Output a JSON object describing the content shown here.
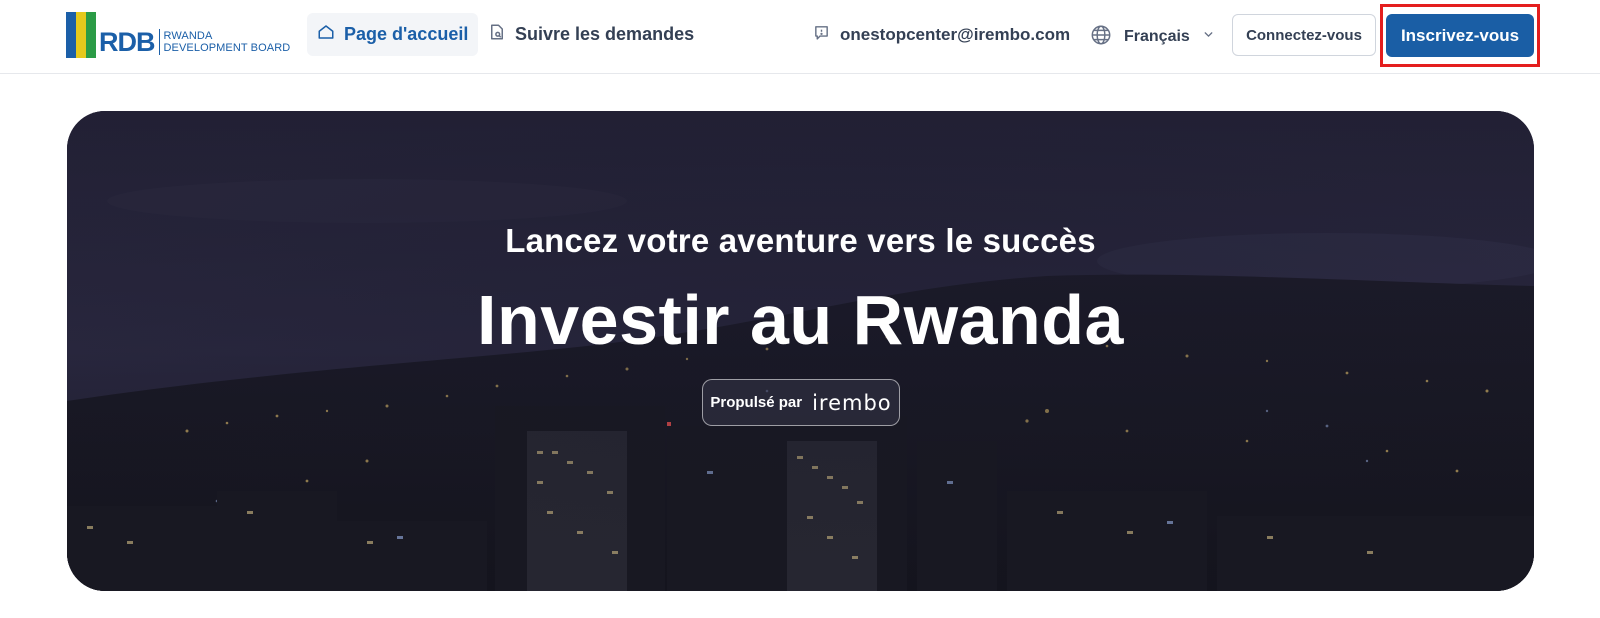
{
  "header": {
    "logo": {
      "abbr": "RDB",
      "line1": "RWANDA",
      "line2": "DEVELOPMENT BOARD",
      "colors": [
        "#1b5fa8",
        "#e5c91d",
        "#2b9b46"
      ]
    },
    "nav": [
      {
        "label": "Page d'accueil",
        "icon": "home-icon",
        "active": true
      },
      {
        "label": "Suivre les demandes",
        "icon": "document-search-icon",
        "active": false
      }
    ],
    "contact_email": "onestopcenter@irembo.com",
    "language": "Français",
    "login_label": "Connectez-vous",
    "signup_label": "Inscrivez-vous"
  },
  "hero": {
    "subtitle": "Lancez votre aventure vers le succès",
    "title": "Investir au Rwanda",
    "powered_by": "Propulsé par",
    "powered_brand": "irembo"
  },
  "colors": {
    "primary": "#1a5ea5",
    "highlight": "#e41e1e",
    "text": "#344054"
  }
}
